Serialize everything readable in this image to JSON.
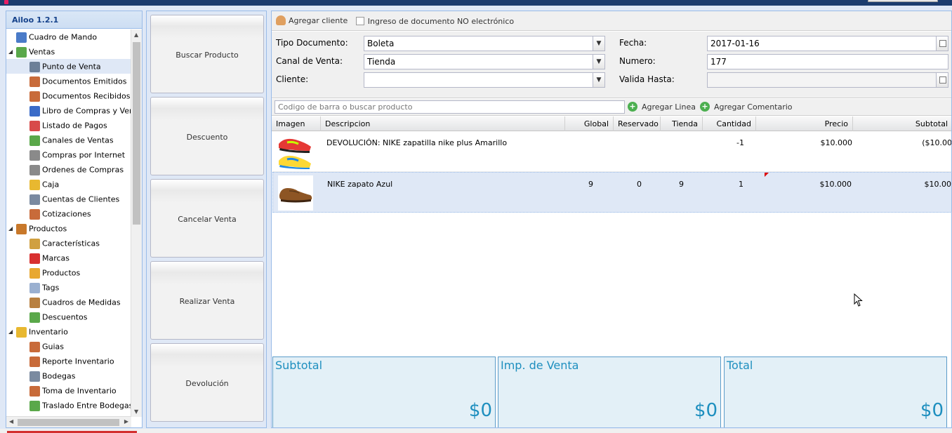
{
  "app": {
    "brand": "Ailoo",
    "title": "Ailoo 1.2.1"
  },
  "colors": {
    "header": "#1b3c6e",
    "accent": "#1e8fbf",
    "selection": "#dfe8f6"
  },
  "tree": [
    {
      "label": "Cuadro de Mando",
      "level": 0,
      "icon": "chart-icon",
      "color": "#4a7bc8",
      "expander": ""
    },
    {
      "label": "Ventas",
      "level": 0,
      "icon": "money-icon",
      "color": "#5aa84a",
      "expander": "◢"
    },
    {
      "label": "Punto de Venta",
      "level": 1,
      "icon": "pos-icon",
      "color": "#6c7f98",
      "selected": true
    },
    {
      "label": "Documentos Emitidos",
      "level": 1,
      "icon": "document-icon",
      "color": "#c86b3a"
    },
    {
      "label": "Documentos Recibidos",
      "level": 1,
      "icon": "document-icon",
      "color": "#c86b3a"
    },
    {
      "label": "Libro de Compras y Ventas",
      "level": 1,
      "icon": "book-icon",
      "color": "#3a6bc8"
    },
    {
      "label": "Listado de Pagos",
      "level": 1,
      "icon": "payment-icon",
      "color": "#d84a4a"
    },
    {
      "label": "Canales de Ventas",
      "level": 1,
      "icon": "money-icon",
      "color": "#5aa84a"
    },
    {
      "label": "Compras por Internet",
      "level": 1,
      "icon": "cart-icon",
      "color": "#8a8a8a"
    },
    {
      "label": "Ordenes de Compras",
      "level": 1,
      "icon": "cart-icon",
      "color": "#8a8a8a"
    },
    {
      "label": "Caja",
      "level": 1,
      "icon": "coins-icon",
      "color": "#e8b830"
    },
    {
      "label": "Cuentas de Clientes",
      "level": 1,
      "icon": "accounts-icon",
      "color": "#7a8aa0"
    },
    {
      "label": "Cotizaciones",
      "level": 1,
      "icon": "document-icon",
      "color": "#c86b3a"
    },
    {
      "label": "Productos",
      "level": 0,
      "icon": "box-icon",
      "color": "#c8782a",
      "expander": "◢"
    },
    {
      "label": "Características",
      "level": 1,
      "icon": "grid-icon",
      "color": "#d0a040"
    },
    {
      "label": "Marcas",
      "level": 1,
      "icon": "ribbon-icon",
      "color": "#d83030"
    },
    {
      "label": "Productos",
      "level": 1,
      "icon": "box-icon",
      "color": "#e8a830"
    },
    {
      "label": "Tags",
      "level": 1,
      "icon": "tag-icon",
      "color": "#9ab0d0"
    },
    {
      "label": "Cuadros de Medidas",
      "level": 1,
      "icon": "ruler-icon",
      "color": "#b88040"
    },
    {
      "label": "Descuentos",
      "level": 1,
      "icon": "money-icon",
      "color": "#5aa84a"
    },
    {
      "label": "Inventario",
      "level": 0,
      "icon": "box-icon",
      "color": "#e8b830",
      "expander": "◢"
    },
    {
      "label": "Guias",
      "level": 1,
      "icon": "guide-icon",
      "color": "#c86b3a"
    },
    {
      "label": "Reporte Inventario",
      "level": 1,
      "icon": "document-icon",
      "color": "#c86b3a"
    },
    {
      "label": "Bodegas",
      "level": 1,
      "icon": "warehouse-icon",
      "color": "#7a8aa0"
    },
    {
      "label": "Toma de Inventario",
      "level": 1,
      "icon": "document-icon",
      "color": "#c86b3a"
    },
    {
      "label": "Traslado Entre Bodegas",
      "level": 1,
      "icon": "truck-icon",
      "color": "#5aa84a"
    }
  ],
  "actions": [
    "Buscar Producto",
    "Descuento",
    "Cancelar Venta",
    "Realizar Venta",
    "Devolución"
  ],
  "toolbar": {
    "add_client": "Agregar cliente",
    "non_electronic": "Ingreso de documento NO electrónico"
  },
  "form": {
    "tipo_label": "Tipo Documento:",
    "tipo_value": "Boleta",
    "canal_label": "Canal de Venta:",
    "canal_value": "Tienda",
    "cliente_label": "Cliente:",
    "cliente_value": "",
    "fecha_label": "Fecha:",
    "fecha_value": "2017-01-16",
    "numero_label": "Numero:",
    "numero_value": "177",
    "valida_label": "Valida Hasta:",
    "valida_value": ""
  },
  "search": {
    "placeholder": "Codigo de barra o buscar producto",
    "add_line": "Agregar Linea",
    "add_comment": "Agregar Comentario"
  },
  "grid": {
    "columns": [
      "Imagen",
      "Descripcion",
      "Global",
      "Reservado",
      "Tienda",
      "Cantidad",
      "Precio",
      "Subtotal"
    ],
    "rows": [
      {
        "descripcion": "DEVOLUCIÓN: NIKE zapatilla nike plus Amarillo",
        "global": "",
        "reservado": "",
        "tienda": "",
        "cantidad": "-1",
        "precio": "$10.000",
        "subtotal": "($10.00"
      },
      {
        "descripcion": "NIKE zapato Azul",
        "global": "9",
        "reservado": "0",
        "tienda": "9",
        "cantidad": "1",
        "precio": "$10.000",
        "subtotal": "$10.00"
      }
    ]
  },
  "totals": {
    "subtotal_label": "Subtotal",
    "subtotal": "$0",
    "tax_label": "Imp. de Venta",
    "tax": "$0",
    "total_label": "Total",
    "total": "$0"
  }
}
